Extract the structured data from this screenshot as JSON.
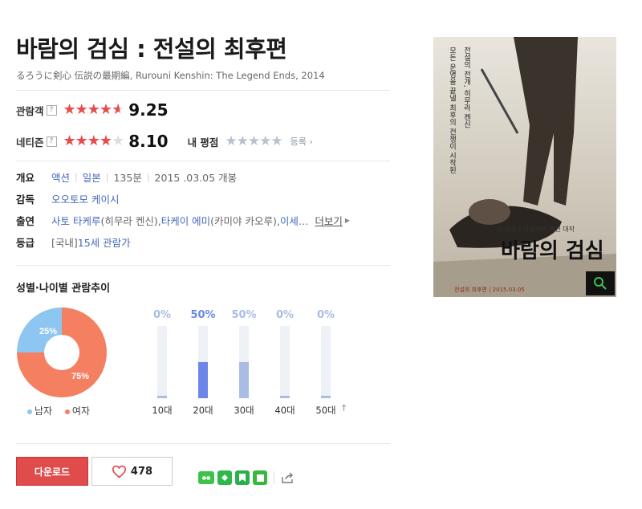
{
  "movie": {
    "title": "바람의 검심 : 전설의 최후편",
    "original_title": "るろうに剣心 伝説の最期編, Rurouni Kenshin: The Legend Ends, 2014"
  },
  "ratings": {
    "audience": {
      "label": "관람객",
      "help": "?",
      "score": "9.25",
      "fraction": 0.925
    },
    "netizen": {
      "label": "네티즌",
      "help": "?",
      "score": "8.10",
      "fraction": 0.81
    },
    "my_rating": {
      "label": "내 평점",
      "register": "등록"
    },
    "star_glyphs": "★★★★★"
  },
  "info": {
    "overview": {
      "key": "개요",
      "genre": "액션",
      "country": "일본",
      "runtime": "135분",
      "release": "2015 .03.05 개봉"
    },
    "director": {
      "key": "감독",
      "name": "오오토모 케이시"
    },
    "cast": {
      "key": "출연",
      "actor1": "사토 타케루",
      "role1": "(히무라 켄신), ",
      "actor2": "타케이 에미",
      "role2": "(카미야 카오루), ",
      "actor3": "이세…",
      "more": "더보기"
    },
    "grade": {
      "key": "등급",
      "prefix": "[국내] ",
      "value": "15세 관람가"
    }
  },
  "trend": {
    "title": "성별·나이별 관람추이",
    "gender": {
      "male_label": "남자",
      "female_label": "여자",
      "male_pct": "25%",
      "female_pct": "75%",
      "male_value": 25,
      "female_value": 75
    },
    "ages": [
      {
        "label": "10대",
        "pct": "0%",
        "value": 0
      },
      {
        "label": "20대",
        "pct": "50%",
        "value": 50
      },
      {
        "label": "30대",
        "pct": "50%",
        "value": 50
      },
      {
        "label": "40대",
        "pct": "0%",
        "value": 0
      },
      {
        "label": "50대",
        "pct": "0%",
        "value": 0
      }
    ],
    "colors": {
      "male": "#8dc6f0",
      "female": "#f57f61",
      "bar_highlight": "#6b86e8",
      "bar_normal": "#a9bde3"
    }
  },
  "actions": {
    "download_label": "다운로드",
    "like_count": "478"
  },
  "poster": {
    "title_text": "바람의 검심",
    "tagline": "신세대 스타일리쉬 액션 대작",
    "vertical_text1": "전설의 전개, 히무라 켄신",
    "vertical_text2": "모든 운명을 끝낼 최후의 전쟁이 시작된다!",
    "footer": "전설의 최후편 | 2015.03.05"
  }
}
